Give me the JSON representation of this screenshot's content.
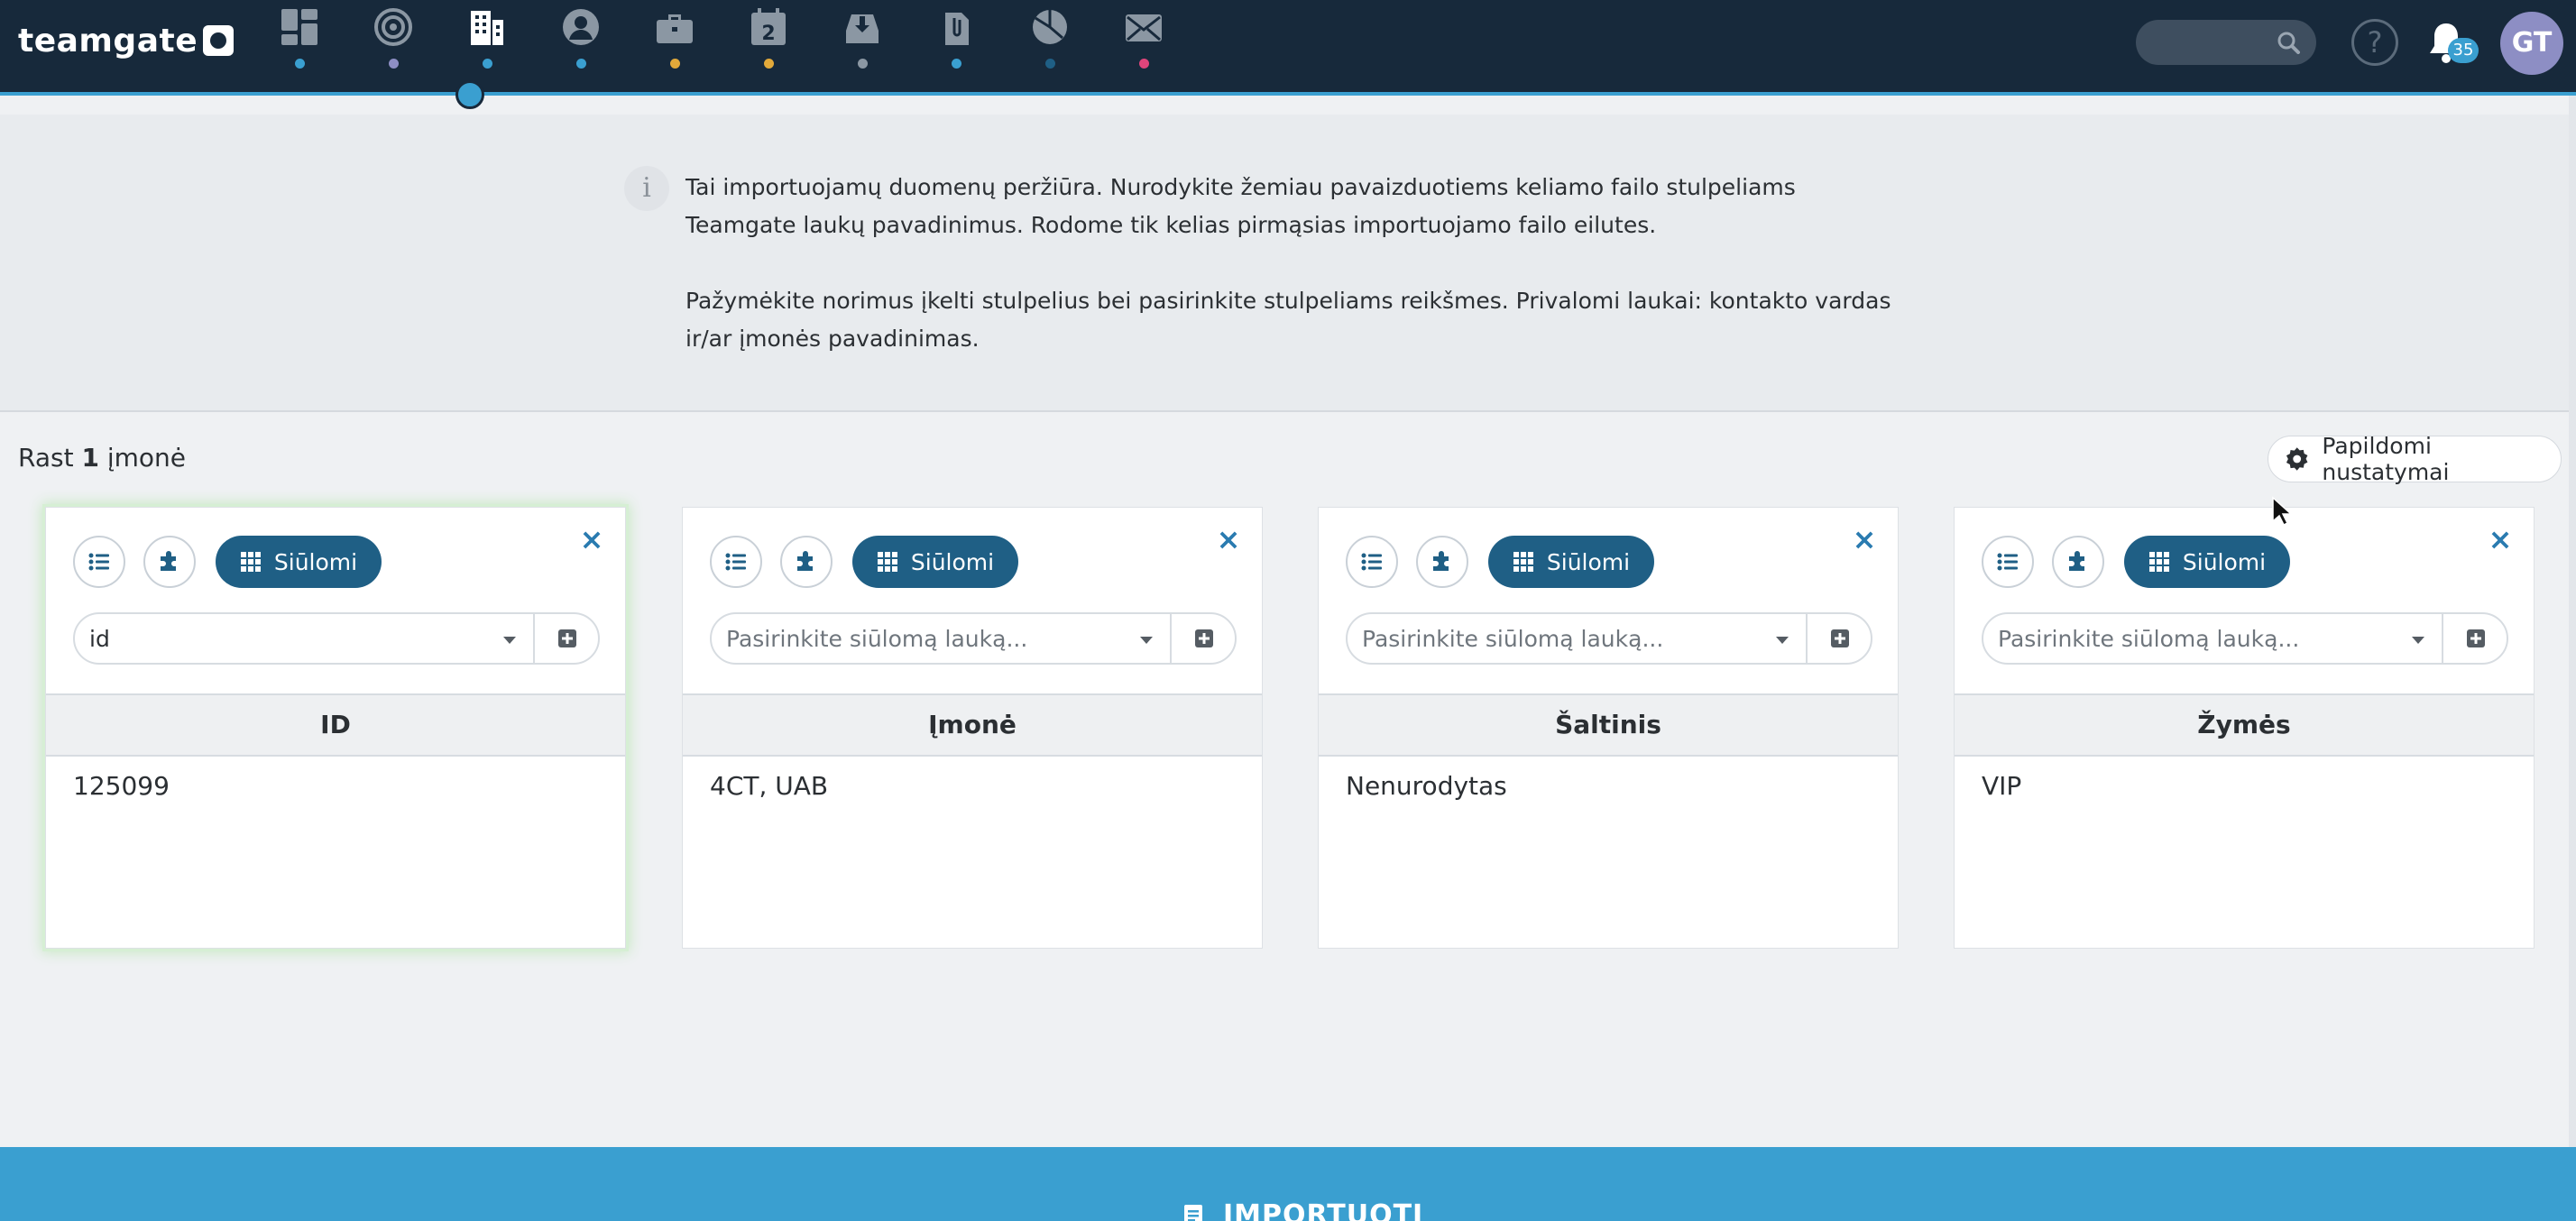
{
  "app": {
    "logo_text": "teamgate"
  },
  "nav": {
    "items": [
      {
        "id": "dashboard",
        "icon": "dashboard-icon",
        "dot_color": "#3a9fd0"
      },
      {
        "id": "leads",
        "icon": "target-icon",
        "dot_color": "#8d8ec4"
      },
      {
        "id": "companies",
        "icon": "building-icon",
        "dot_color": "#3a9fd0",
        "active": true
      },
      {
        "id": "people",
        "icon": "person-icon",
        "dot_color": "#3a9fd0"
      },
      {
        "id": "deals",
        "icon": "briefcase-icon",
        "dot_color": "#e2a93a"
      },
      {
        "id": "calendar",
        "icon": "calendar-icon",
        "day": "2",
        "dot_color": "#e2a93a"
      },
      {
        "id": "inbox",
        "icon": "inbox-icon",
        "dot_color": "#8b97a3"
      },
      {
        "id": "files",
        "icon": "attachment-icon",
        "dot_color": "#3a9fd0"
      },
      {
        "id": "reports",
        "icon": "pie-chart-icon",
        "dot_color": "#1f5f85"
      },
      {
        "id": "email",
        "icon": "envelope-icon",
        "dot_color": "#e0457b"
      }
    ]
  },
  "topbar": {
    "help_glyph": "?",
    "notifications_count": "35",
    "avatar_initials": "GT"
  },
  "info": {
    "paragraph1": "Tai importuojamų duomenų peržiūra. Nurodykite žemiau pavaizduotiems keliamo failo stulpeliams Teamgate laukų pavadinimus. Rodome tik kelias pirmąsias importuojamo failo eilutes.",
    "paragraph2": "Pažymėkite norimus įkelti stulpelius bei pasirinkite stulpeliams reikšmes. Privalomi laukai: kontakto vardas ir/ar įmonės pavadinimas."
  },
  "summary": {
    "prefix": "Rast",
    "count": "1",
    "suffix": "įmonė"
  },
  "settings_button": {
    "label": "Papildomi nustatymai"
  },
  "cards": [
    {
      "suggested_label": "Siūlomi",
      "field_value": "id",
      "field_placeholder": "Pasirinkite siūlomą lauką...",
      "header": "ID",
      "value": "125099",
      "selected": true
    },
    {
      "suggested_label": "Siūlomi",
      "field_value": "",
      "field_placeholder": "Pasirinkite siūlomą lauką...",
      "header": "Įmonė",
      "value": "4CT, UAB",
      "selected": false
    },
    {
      "suggested_label": "Siūlomi",
      "field_value": "",
      "field_placeholder": "Pasirinkite siūlomą lauką...",
      "header": "Šaltinis",
      "value": "Nenurodytas",
      "selected": false
    },
    {
      "suggested_label": "Siūlomi",
      "field_value": "",
      "field_placeholder": "Pasirinkite siūlomą lauką...",
      "header": "Žymės",
      "value": "VIP",
      "selected": false
    }
  ],
  "import_button": {
    "label": "IMPORTUOTI"
  },
  "colors": {
    "topbar": "#17293b",
    "accent": "#3a9fd0",
    "primary_button": "#1f5f85",
    "close_icon": "#2a7bb0",
    "selected_glow": "#c6e8c2"
  }
}
